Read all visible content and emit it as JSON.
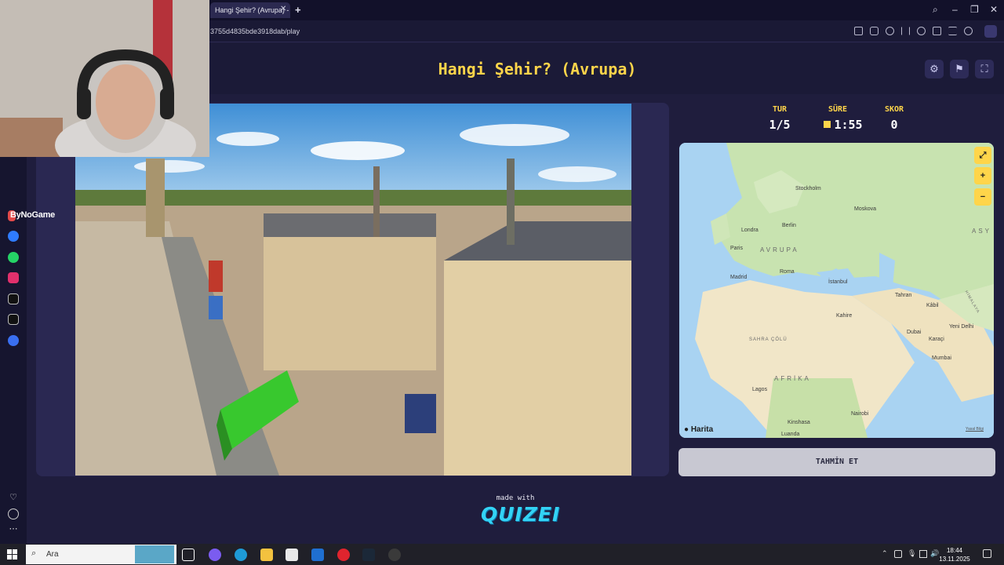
{
  "browser": {
    "tab_title": "Hangi Şehir? (Avrupa) - Q",
    "url": "3755d4835bde3918dab/play"
  },
  "quiz": {
    "title": "Hangi Şehir? (Avrupa)",
    "stats": {
      "round_label": "TUR",
      "round_value": "1/5",
      "time_label": "SÜRE",
      "time_value": "1:55",
      "score_label": "SKOR",
      "score_value": "0"
    },
    "guess_button": "TAHMİN ET",
    "made_with": "made with",
    "brand": "QUIZEI"
  },
  "map": {
    "attribution": "Harita",
    "legal": "Yasal Bilgi",
    "regions": [
      "AVRUPA",
      "AFRİKA",
      "ASY",
      "SAHRA ÇÖLÜ",
      "HİMALAYA"
    ],
    "cities": [
      "Stockholm",
      "Moskova",
      "Berlin",
      "Londra",
      "Paris",
      "Roma",
      "Madrid",
      "İstanbul",
      "Tahran",
      "Kâbil",
      "Kahire",
      "Yeni Delhi",
      "Dubai",
      "Karaçi",
      "Mumbai",
      "Lagos",
      "Nairobi",
      "Kinshasa",
      "Luanda"
    ]
  },
  "sidebar": {
    "brand": "ByNoGame"
  },
  "taskbar": {
    "search_placeholder": "Ara",
    "time": "18:44",
    "date": "13.11.2025"
  }
}
